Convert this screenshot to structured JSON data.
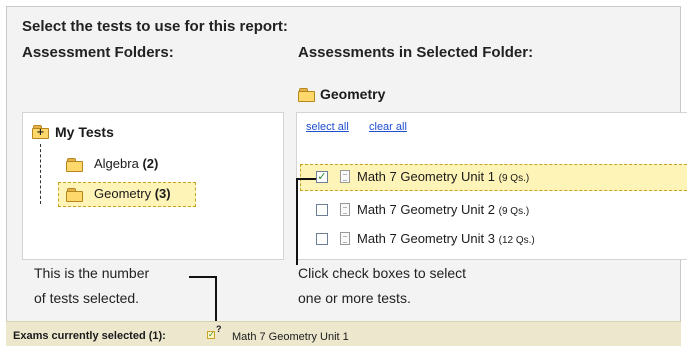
{
  "header": {
    "title": "Select the tests to use for this report:",
    "folders_heading": "Assessment Folders:",
    "assessments_heading": "Assessments in Selected Folder:"
  },
  "selected_folder_name": "Geometry",
  "tree": {
    "root_label": "My Tests",
    "folders": [
      {
        "name": "Algebra",
        "count": "(2)"
      },
      {
        "name": "Geometry",
        "count": "(3)"
      }
    ]
  },
  "links": {
    "select_all": "select all",
    "clear_all": "clear all"
  },
  "tests": [
    {
      "name": "Math 7 Geometry Unit 1",
      "qs": "(9 Qs.)",
      "checked": true
    },
    {
      "name": "Math 7 Geometry Unit 2",
      "qs": "(9 Qs.)",
      "checked": false
    },
    {
      "name": "Math 7 Geometry Unit 3",
      "qs": "(12 Qs.)",
      "checked": false
    }
  ],
  "callouts": {
    "count_line1": "This is the number",
    "count_line2": "of tests selected.",
    "checkbox_line1": "Click check boxes to select",
    "checkbox_line2": "one or more tests."
  },
  "status": {
    "label": "Exams currently selected (1):",
    "question_mark": "?",
    "selected_test": "Math 7 Geometry Unit 1"
  },
  "icons": {
    "folder": "folder-icon",
    "folder_expand": "folder-expand-icon",
    "document": "document-icon",
    "checkbox": "checkbox-icon"
  },
  "colors": {
    "highlight": "#fff4b8",
    "link": "#1f4fd0",
    "status_bar": "#ece7cd"
  }
}
